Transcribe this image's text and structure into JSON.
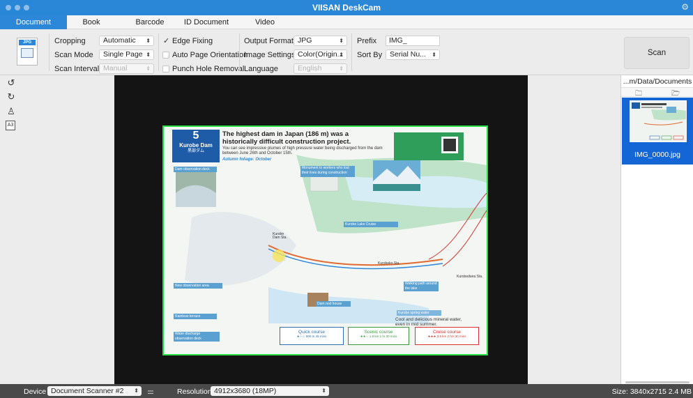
{
  "window": {
    "title": "VIISAN DeskCam"
  },
  "tabs": [
    {
      "label": "Document",
      "active": true
    },
    {
      "label": "Book"
    },
    {
      "label": "Barcode"
    },
    {
      "label": "ID Document"
    },
    {
      "label": "Video"
    }
  ],
  "format_icon": {
    "label": "JPG"
  },
  "settings": {
    "cropping": {
      "label": "Cropping",
      "value": "Automatic"
    },
    "scan_mode": {
      "label": "Scan Mode",
      "value": "Single Page"
    },
    "scan_interval": {
      "label": "Scan Interval",
      "value": "Manual"
    },
    "edge_fixing": {
      "label": "Edge Fixing",
      "checked": true
    },
    "auto_orientation": {
      "label": "Auto Page Orientation",
      "checked": false
    },
    "punch_hole": {
      "label": "Punch Hole Removal",
      "checked": false
    },
    "output_format": {
      "label": "Output Format",
      "value": "JPG"
    },
    "image_settings": {
      "label": "Image Settings",
      "value": "Color(Origin..."
    },
    "language": {
      "label": "Language",
      "value": "English"
    },
    "prefix": {
      "label": "Prefix",
      "value": "IMG_"
    },
    "sort_by": {
      "label": "Sort By",
      "value": "Serial Nu..."
    },
    "check_mark": "✓"
  },
  "scan_button": {
    "label": "Scan"
  },
  "left_tools": [
    {
      "icon": "rotate-left-icon",
      "glyph": "↺"
    },
    {
      "icon": "rotate-right-icon",
      "glyph": "↻"
    },
    {
      "icon": "stamp-icon",
      "glyph": "♙"
    },
    {
      "icon": "paper-size-a3-icon",
      "glyph": "A3"
    }
  ],
  "files": {
    "path": "...m/Data/Documents",
    "items": [
      {
        "name": "IMG_0000.jpg",
        "selected": true
      }
    ]
  },
  "status": {
    "device_label": "Device",
    "device_value": "Document Scanner #2",
    "resolution_label": "Resolution",
    "resolution_value": "4912x3680 (18MP)",
    "size_text": "Size: 3840x2715 2.4 MB"
  },
  "poster": {
    "number": "5",
    "name": "Kurobe Dam",
    "name_jp": "黒部ダム",
    "title": "The highest dam in Japan (186 m) was a historically difficult construction project.",
    "subtitle": "You can see impressive plumes of high pressure water being discharged from the dam between June 26th and October 15th.",
    "autumn": "Autumn foliage: October",
    "tags": {
      "dam_observation": "Dam observation deck",
      "monument": "Monument to workers who lost their lives during construction",
      "new_observation": "New observation area",
      "rainbow": "Rainbow terrace",
      "discharge": "Water discharge observation deck",
      "walking_path": "Walking path around the lake",
      "lake_cruise": "Kurobe Lake Cruise",
      "dam_lounge": "Dam rest house",
      "spring_water": "Kurobe spring water"
    },
    "notes": {
      "cool_water": "Cool and delicious mineral water, even in mid summer."
    },
    "stations": {
      "kurobe_dam": "Kurobe Dam Sta.",
      "kurobeko": "Kurobeko Sta.",
      "kurobedaira": "Kurobedaira Sta."
    },
    "courses": [
      {
        "name": "Quick course",
        "detail": "★☆☆ 800 m  45 mins",
        "color": "#2d6fb5"
      },
      {
        "name": "Scenic course",
        "detail": "★★☆ 1.8 km  1 hr 30 mins",
        "color": "#3a9a3a"
      },
      {
        "name": "Cruise course",
        "detail": "★★★ 3.6 km  2 hrs 30 mins",
        "color": "#d9342b"
      }
    ]
  }
}
